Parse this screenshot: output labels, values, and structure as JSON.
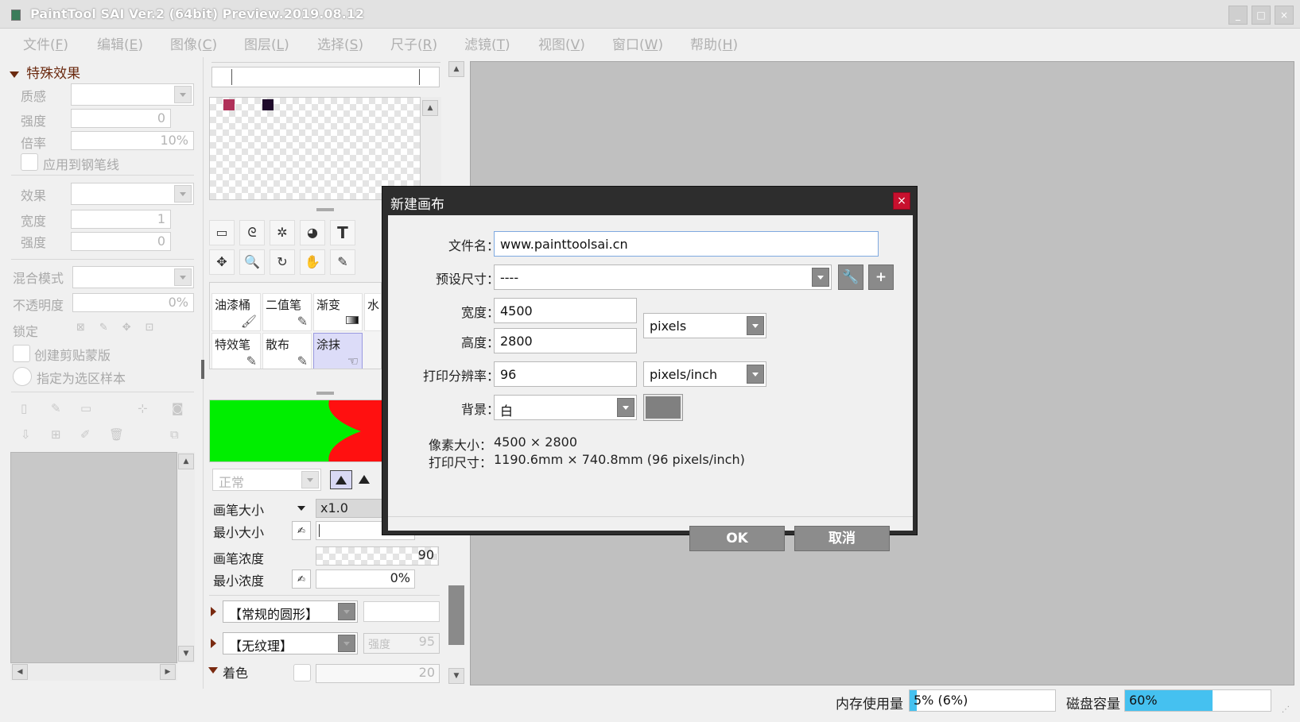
{
  "window": {
    "title": "PaintTool SAI Ver.2 (64bit) Preview.2019.08.12",
    "min_glyph": "_",
    "max_glyph": "□",
    "close_glyph": "×"
  },
  "menu": [
    {
      "label": "文件(",
      "key": "F",
      "end": ")"
    },
    {
      "label": "编辑(",
      "key": "E",
      "end": ")"
    },
    {
      "label": "图像(",
      "key": "C",
      "end": ")"
    },
    {
      "label": "图层(",
      "key": "L",
      "end": ")"
    },
    {
      "label": "选择(",
      "key": "S",
      "end": ")"
    },
    {
      "label": "尺子(",
      "key": "R",
      "end": ")"
    },
    {
      "label": "滤镜(",
      "key": "T",
      "end": ")"
    },
    {
      "label": "视图(",
      "key": "V",
      "end": ")"
    },
    {
      "label": "窗口(",
      "key": "W",
      "end": ")"
    },
    {
      "label": "帮助(",
      "key": "H",
      "end": ")"
    }
  ],
  "left_panel": {
    "section_title": "特殊效果",
    "quality_label": "质感",
    "strength_label": "强度",
    "strength_value": "0",
    "rate_label": "倍率",
    "rate_value": "10%",
    "apply_pen_label": "应用到钢笔线",
    "effect_label": "效果",
    "width_label": "宽度",
    "width_value": "1",
    "strength2_label": "强度",
    "strength2_value": "0",
    "blend_label": "混合模式",
    "opacity_label": "不透明度",
    "opacity_value": "0%",
    "lock_label": "锁定",
    "clip_label": "创建剪贴蒙版",
    "sample_label": "指定为选区样本"
  },
  "middle_panel": {
    "tools": [
      "▭",
      "ᘓ",
      "✲",
      "◕",
      "T",
      "✥",
      "🔍",
      "↻",
      "✋",
      "✎"
    ],
    "brushes": [
      {
        "label": "油漆桶",
        "icon": "🖌"
      },
      {
        "label": "二值笔",
        "icon": "✎"
      },
      {
        "label": "渐变",
        "icon": "▭"
      },
      {
        "label": "特效笔",
        "icon": "✎"
      },
      {
        "label": "散布",
        "icon": "✎"
      },
      {
        "label": "涂抹",
        "icon": "☜"
      },
      {
        "label": "水",
        "icon": ""
      }
    ],
    "palette_colors": [
      "#b0325a",
      "#1e0a2a"
    ],
    "mode_value": "正常",
    "brush_size_label": "画笔大小",
    "brush_size_value": "x1.0",
    "min_size_label": "最小大小",
    "density_label": "画笔浓度",
    "density_value": "90",
    "min_density_label": "最小浓度",
    "min_density_value": "0%",
    "shape_value": "【常规的圆形】",
    "texture_value": "【无纹理】",
    "texture_strength_label": "强度",
    "texture_strength_value": "95",
    "coloring_label": "着色",
    "coloring_value": "20",
    "scroll_up_glyph": "▲",
    "scroll_down_glyph": "▼",
    "scroll_left_glyph": "◀",
    "scroll_right_glyph": "▶"
  },
  "status_bar": {
    "memory_label": "内存使用量",
    "memory_value": "5% (6%)",
    "memory_fraction": 0.05,
    "disk_label": "磁盘容量",
    "disk_value": "60%",
    "disk_fraction": 0.6
  },
  "dialog": {
    "title": "新建画布",
    "close_glyph": "×",
    "filename_label": "文件名：",
    "filename_value": "www.painttoolsai.cn",
    "preset_label": "预设尺寸：",
    "preset_value": "----",
    "wrench_glyph": "🔧",
    "plus_glyph": "+",
    "width_label": "宽度：",
    "width_value": "4500",
    "height_label": "高度：",
    "height_value": "2800",
    "unit_value": "pixels",
    "dpi_label": "打印分辨率：",
    "dpi_value": "96",
    "dpi_unit_value": "pixels/inch",
    "bg_label": "背景：",
    "bg_value": "白",
    "bg_color": "#808080",
    "pixel_size_label": "像素大小：",
    "pixel_size_value": "4500 × 2800",
    "print_size_label": "打印尺寸：",
    "print_size_value": "1190.6mm × 740.8mm (96 pixels/inch)",
    "ok_label": "OK",
    "cancel_label": "取消"
  }
}
